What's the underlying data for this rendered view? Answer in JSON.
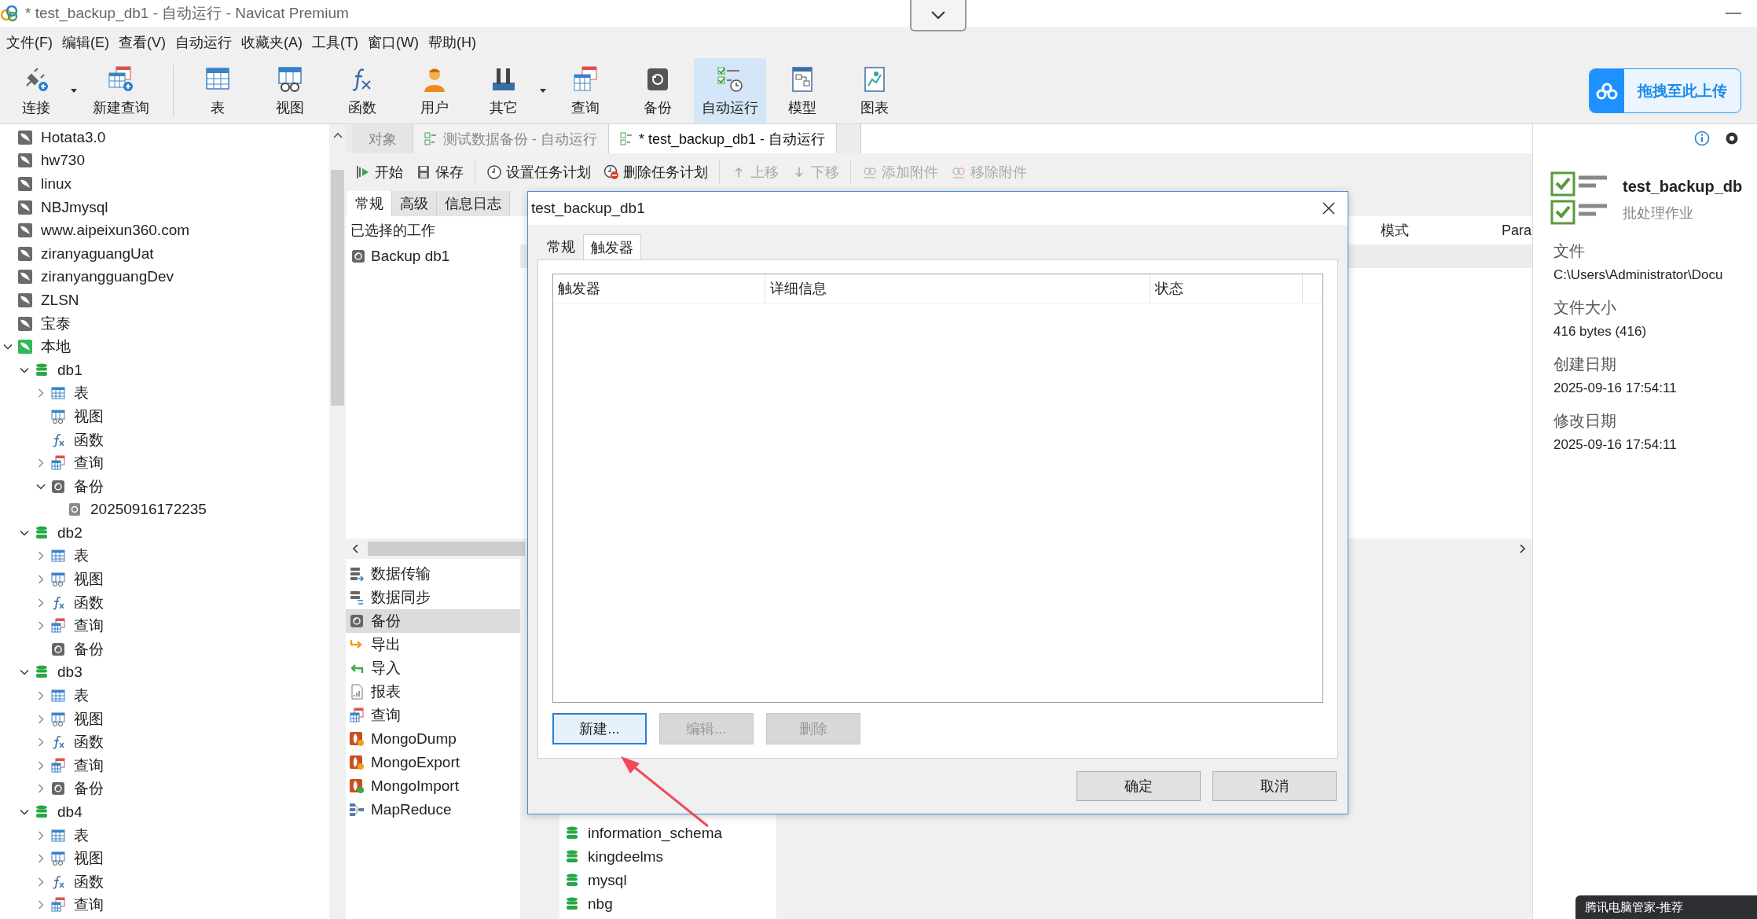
{
  "window": {
    "title": "* test_backup_db1 - 自动运行 - Navicat Premium"
  },
  "menu": [
    "文件(F)",
    "编辑(E)",
    "查看(V)",
    "自动运行",
    "收藏夹(A)",
    "工具(T)",
    "窗口(W)",
    "帮助(H)"
  ],
  "toolbar": [
    {
      "label": "连接",
      "kind": "connect",
      "dropdown": true,
      "selected": false
    },
    {
      "label": "新建查询",
      "kind": "new-query",
      "dropdown": false,
      "selected": false
    },
    {
      "label": "表",
      "kind": "table",
      "dropdown": false,
      "selected": false
    },
    {
      "label": "视图",
      "kind": "view",
      "dropdown": false,
      "selected": false
    },
    {
      "label": "函数",
      "kind": "function",
      "dropdown": false,
      "selected": false
    },
    {
      "label": "用户",
      "kind": "user",
      "dropdown": false,
      "selected": false
    },
    {
      "label": "其它",
      "kind": "tools",
      "dropdown": true,
      "selected": false
    },
    {
      "label": "查询",
      "kind": "query",
      "dropdown": false,
      "selected": false
    },
    {
      "label": "备份",
      "kind": "backup",
      "dropdown": false,
      "selected": false
    },
    {
      "label": "自动运行",
      "kind": "automation",
      "dropdown": false,
      "selected": true
    },
    {
      "label": "模型",
      "kind": "model",
      "dropdown": false,
      "selected": false
    },
    {
      "label": "图表",
      "kind": "chart",
      "dropdown": false,
      "selected": false
    }
  ],
  "upload_button": {
    "label": "拖拽至此上传"
  },
  "navigator": {
    "items": [
      {
        "label": "Hotata3.0",
        "kind": "connection",
        "connected": false
      },
      {
        "label": "hw730",
        "kind": "connection",
        "connected": false
      },
      {
        "label": "linux",
        "kind": "connection",
        "connected": false
      },
      {
        "label": "NBJmysql",
        "kind": "connection",
        "connected": false
      },
      {
        "label": "www.aipeixun360.com",
        "kind": "connection",
        "connected": false
      },
      {
        "label": "ziranyaguangUat",
        "kind": "connection",
        "connected": false
      },
      {
        "label": "ziranyangguangDev",
        "kind": "connection",
        "connected": false
      },
      {
        "label": "ZLSN",
        "kind": "connection",
        "connected": false
      },
      {
        "label": "宝泰",
        "kind": "connection",
        "connected": false
      },
      {
        "label": "本地",
        "kind": "connection",
        "connected": true,
        "expanded": true,
        "children": [
          {
            "label": "db1",
            "kind": "database",
            "expanded": true,
            "children": [
              {
                "label": "表",
                "kind": "table",
                "expanded": false
              },
              {
                "label": "视图",
                "kind": "view"
              },
              {
                "label": "函数",
                "kind": "function"
              },
              {
                "label": "查询",
                "kind": "query",
                "expanded": false
              },
              {
                "label": "备份",
                "kind": "backup",
                "expanded": true,
                "children": [
                  {
                    "label": "20250916172235",
                    "kind": "backup-file"
                  }
                ]
              }
            ]
          },
          {
            "label": "db2",
            "kind": "database",
            "expanded": true,
            "children": [
              {
                "label": "表",
                "kind": "table",
                "expanded": false
              },
              {
                "label": "视图",
                "kind": "view",
                "expanded": false
              },
              {
                "label": "函数",
                "kind": "function",
                "expanded": false
              },
              {
                "label": "查询",
                "kind": "query",
                "expanded": false
              },
              {
                "label": "备份",
                "kind": "backup"
              }
            ]
          },
          {
            "label": "db3",
            "kind": "database",
            "expanded": true,
            "children": [
              {
                "label": "表",
                "kind": "table",
                "expanded": false
              },
              {
                "label": "视图",
                "kind": "view",
                "expanded": false
              },
              {
                "label": "函数",
                "kind": "function",
                "expanded": false
              },
              {
                "label": "查询",
                "kind": "query",
                "expanded": false
              },
              {
                "label": "备份",
                "kind": "backup",
                "expanded": false
              }
            ]
          },
          {
            "label": "db4",
            "kind": "database",
            "expanded": true,
            "children": [
              {
                "label": "表",
                "kind": "table",
                "expanded": false
              },
              {
                "label": "视图",
                "kind": "view",
                "expanded": false
              },
              {
                "label": "函数",
                "kind": "function",
                "expanded": false
              },
              {
                "label": "查询",
                "kind": "query",
                "expanded": false
              }
            ]
          }
        ]
      }
    ]
  },
  "document_tabs": [
    {
      "label": "对象",
      "kind": "objects",
      "selected": false
    },
    {
      "label": "测试数据备份 - 自动运行",
      "kind": "automation",
      "selected": false
    },
    {
      "label": "* test_backup_db1 - 自动运行",
      "kind": "automation",
      "selected": true
    }
  ],
  "actions": [
    {
      "label": "开始",
      "kind": "start",
      "disabled": false
    },
    {
      "label": "保存",
      "kind": "save",
      "disabled": false
    },
    {
      "label": "设置任务计划",
      "kind": "schedule",
      "disabled": false
    },
    {
      "label": "删除任务计划",
      "kind": "unschedule",
      "disabled": false
    },
    {
      "label": "上移",
      "kind": "up",
      "disabled": true
    },
    {
      "label": "下移",
      "kind": "down",
      "disabled": true
    },
    {
      "label": "添加附件",
      "kind": "attach",
      "disabled": true
    },
    {
      "label": "移除附件",
      "kind": "detach",
      "disabled": true
    }
  ],
  "job_tabs": [
    {
      "label": "常规",
      "selected": true
    },
    {
      "label": "高级",
      "selected": false
    },
    {
      "label": "信息日志",
      "selected": false
    }
  ],
  "job_list": {
    "heading": "已选择的工作",
    "items": [
      {
        "label": "Backup db1"
      }
    ]
  },
  "job_columns": [
    "模式",
    "Para"
  ],
  "job_types": [
    {
      "label": "数据传输",
      "kind": "transfer",
      "selected": false
    },
    {
      "label": "数据同步",
      "kind": "sync",
      "selected": false
    },
    {
      "label": "备份",
      "kind": "backup",
      "selected": true
    },
    {
      "label": "导出",
      "kind": "export",
      "selected": false
    },
    {
      "label": "导入",
      "kind": "import",
      "selected": false
    },
    {
      "label": "报表",
      "kind": "report",
      "selected": false
    },
    {
      "label": "查询",
      "kind": "query",
      "selected": false
    },
    {
      "label": "MongoDump",
      "kind": "mongo-dump",
      "selected": false
    },
    {
      "label": "MongoExport",
      "kind": "mongo-export",
      "selected": false
    },
    {
      "label": "MongoImport",
      "kind": "mongo-import",
      "selected": false
    },
    {
      "label": "MapReduce",
      "kind": "map-reduce",
      "selected": false
    }
  ],
  "databases": [
    "information_schema",
    "kingdeelms",
    "mysql",
    "nbg"
  ],
  "dialog": {
    "title": "test_backup_db1",
    "tabs": [
      {
        "label": "常规",
        "selected": false
      },
      {
        "label": "触发器",
        "selected": true
      }
    ],
    "columns": [
      "触发器",
      "详细信息",
      "状态"
    ],
    "buttons": [
      {
        "label": "新建...",
        "disabled": false,
        "focused": true
      },
      {
        "label": "编辑...",
        "disabled": true,
        "focused": false
      },
      {
        "label": "删除",
        "disabled": true,
        "focused": false
      }
    ],
    "footer_buttons": [
      "确定",
      "取消"
    ]
  },
  "details": {
    "title": "test_backup_db",
    "subtitle": "批处理作业",
    "fields": [
      {
        "label": "文件",
        "value": "C:\\Users\\Administrator\\Docu"
      },
      {
        "label": "文件大小",
        "value": "416 bytes (416)"
      },
      {
        "label": "创建日期",
        "value": "2025-09-16 17:54:11"
      },
      {
        "label": "修改日期",
        "value": "2025-09-16 17:54:11"
      }
    ]
  },
  "notification": {
    "text": "腾讯电脑管家-推荐"
  }
}
